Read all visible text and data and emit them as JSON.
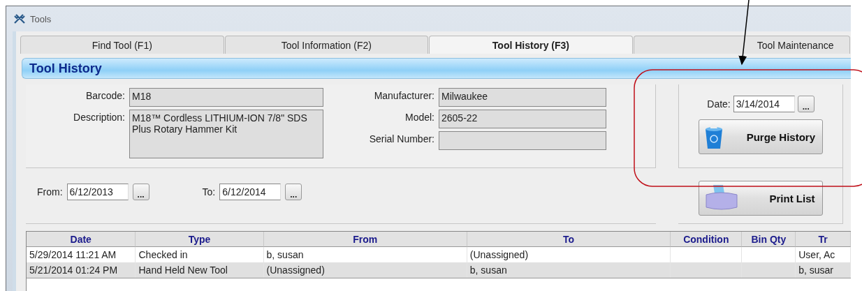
{
  "window": {
    "title": "Tools"
  },
  "tabs": [
    {
      "label": "Find Tool (F1)",
      "selected": false
    },
    {
      "label": "Tool Information (F2)",
      "selected": false
    },
    {
      "label": "Tool History (F3)",
      "selected": true
    },
    {
      "label": "Tool Maintenance",
      "selected": false
    }
  ],
  "section_title": "Tool History",
  "details_left": [
    {
      "label": "Barcode:",
      "value": "M18",
      "kind": "single"
    },
    {
      "label": "Description:",
      "value": "M18™ Cordless LITHIUM-ION 7/8\" SDS Plus Rotary Hammer Kit",
      "kind": "multi"
    }
  ],
  "details_right": [
    {
      "label": "Manufacturer:",
      "value": "Milwaukee"
    },
    {
      "label": "Model:",
      "value": "2605-22"
    },
    {
      "label": "Serial Number:"
    }
  ],
  "purge": {
    "date_label": "Date:",
    "date_value": "3/14/2014",
    "picker": "...",
    "button": "Purge History"
  },
  "filter": {
    "from_label": "From:",
    "from_value": "6/12/2013",
    "from_picker": "...",
    "to_label": "To:",
    "to_value": "6/12/2014",
    "to_picker": "..."
  },
  "print_button": "Print List",
  "table": {
    "columns": [
      "Date",
      "Type",
      "From",
      "To",
      "Condition",
      "Bin Qty",
      "Tr"
    ],
    "rows": [
      [
        "5/29/2014 11:21 AM",
        "Checked in",
        "b, susan",
        "(Unassigned)",
        "",
        "",
        "User, Ac"
      ],
      [
        "5/21/2014 01:24 PM",
        "Hand Held New Tool",
        "(Unassigned)",
        "b, susan",
        "",
        "",
        "b, susar"
      ]
    ]
  }
}
